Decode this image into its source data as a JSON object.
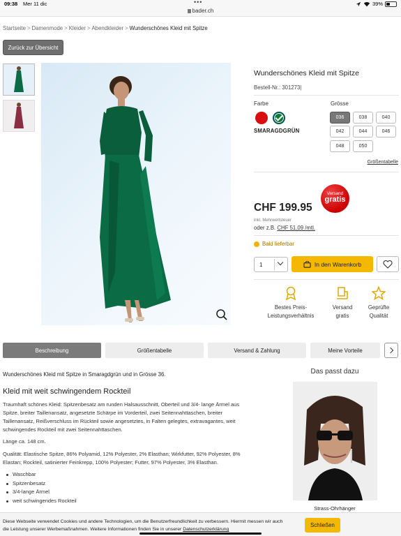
{
  "status_bar": {
    "time": "09:38",
    "date": "Mer 11 dic",
    "url": "bader.ch",
    "battery": "39%",
    "battery_level": 0.39,
    "menu_dots": "•••"
  },
  "breadcrumb": [
    {
      "label": "Startseite"
    },
    {
      "label": "Damenmode"
    },
    {
      "label": "Kleider"
    },
    {
      "label": "Abendkleider"
    }
  ],
  "breadcrumb_current": "Wunderschönes Kleid mit Spitze",
  "breadcrumb_separator": ">",
  "back_button": "Zurück zur Übersicht",
  "product": {
    "title": "Wunderschönes Kleid mit Spitze",
    "order_no": "Bestell-Nr.: 301273|",
    "color_label": "Farbe",
    "colors": [
      {
        "name": "red",
        "hex": "#d90f0f"
      },
      {
        "name": "green",
        "hex": "#0a7a35",
        "selected": true
      }
    ],
    "selected_color": "SMARAGDGRÜN",
    "size_label": "Grösse",
    "sizes": [
      "036",
      "038",
      "040",
      "042",
      "044",
      "046",
      "048",
      "050"
    ],
    "selected_size": "036",
    "size_chart_link": "Größentabelle",
    "badge_line1": "Versand",
    "badge_line2": "gratis",
    "price": "CHF 199.95",
    "vat": "inkl. Mehrwertsteuer",
    "monthly_prefix": "oder z.B.",
    "monthly_amount": "CHF 51.09 /mtl.",
    "availability": "Bald lieferbar",
    "quantity": "1",
    "add_to_cart": "In den Warenkorb",
    "usps": [
      {
        "line1": "Bestes Preis-",
        "line2": "Leistungsverhältnis",
        "icon": "award-icon"
      },
      {
        "line1": "Versand",
        "line2": "gratis",
        "icon": "shipping-icon"
      },
      {
        "line1": "Geprüfte",
        "line2": "Qualität",
        "icon": "star-icon"
      }
    ]
  },
  "tabs": [
    "Beschreibung",
    "Größentabelle",
    "Versand & Zahlung",
    "Meine Vorteile"
  ],
  "active_tab": "Beschreibung",
  "description": {
    "intro": "Wunderschönes Kleid mit Spitze in Smaragdgrün und in Grösse 36.",
    "heading": "Kleid mit weit schwingendem Rockteil",
    "para1_lead": "Traumhaft schönes Kleid:",
    "para1_lines": [
      " Spitzenbesatz am runden Halsausschnitt, Oberteil und 3/4- lange Ärmel aus",
      "Spitze, breiter Taillenansatz, angesetzte Schärpe im Vorderteil, zwei Seitennahttaschen, breiter",
      "Taillenansatz, Reißverschluss im Rückteil sowie angesetztes, in Falten gelegtes, extravagantes, weit",
      "schwingendes Rockteil mit zwei Seitennahttaschen."
    ],
    "length": "Länge ca. 148 cm.",
    "quality_lines": [
      "Qualität: Elastische Spitze, 86% Polyamid, 12% Polyester, 2% Elasthan; Wirkfutter, 92% Polyester, 8%",
      "Elastan; Rockteil, satinierter Feinkrepp, 100% Polyester; Futter, 97% Polyester, 3% Elasthan."
    ],
    "bullets": [
      "Waschbar",
      "Spitzenbesatz",
      "3/4-lange Ärmel",
      "weit schwingendes Rockteil"
    ]
  },
  "also": {
    "heading": "Das passt dazu",
    "caption": "Strass-Ohrhänger"
  },
  "cookie": {
    "line1": "Diese Webseite verwendet Cookies und andere Technologien, um die Benutzerfreundlichkeit zu verbessern. Hiermit messen wir auch",
    "line2_prefix": "die Leistung unserer Werbemaßnahmen. Weitere Informationen finden Sie in unserer ",
    "link": "Datenschutzerklärung",
    "button": "Schließen"
  },
  "colors": {
    "accent": "#f5b800",
    "badge": "#cc0000",
    "dress": "#0a6b45"
  }
}
